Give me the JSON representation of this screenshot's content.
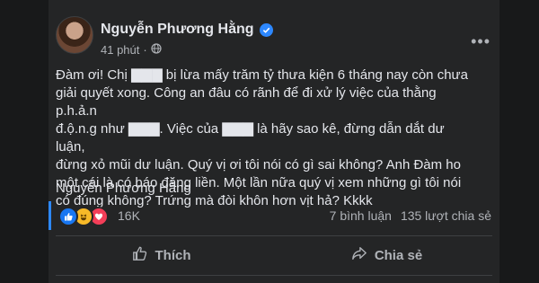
{
  "post": {
    "author": "Nguyễn Phương Hằng",
    "time": "41 phút",
    "privacy_icon": "globe-icon",
    "verified_icon": "verified-badge-icon",
    "text": "Đàm ơi! Chị ▇▇▇ bị lừa mấy trăm tỷ thưa kiện 6 tháng nay còn chưa\ngiải quyết xong. Công an đâu có rãnh để đi xử lý việc của thằng p.h.ả.n\nđ.ộ.n.g như ▇▇▇. Việc của ▇▇▇ là hãy sao kê, đừng dẫn dắt dư luận,\nđừng xỏ mũi dư luận. Quý vị ơi tôi nói có gì sai không? Anh Đàm ho\nmột cái là có báo đăng liền. Một lần nữa quý vị xem những gì tôi nói\ncó đúng không? Trứng mà đòi khôn hơn vịt hả? Kkkk",
    "signature": "Nguyễn Phương Hằng"
  },
  "reactions": {
    "icons": [
      "like-icon",
      "haha-icon",
      "love-icon"
    ],
    "count": "16K",
    "comments": "7 bình luận",
    "shares": "135 lượt chia sẻ"
  },
  "actions": {
    "like_label": "Thích",
    "share_label": "Chia sẻ"
  },
  "colors": {
    "background": "#18191a",
    "card": "#242526",
    "accent": "#2d88ff"
  }
}
